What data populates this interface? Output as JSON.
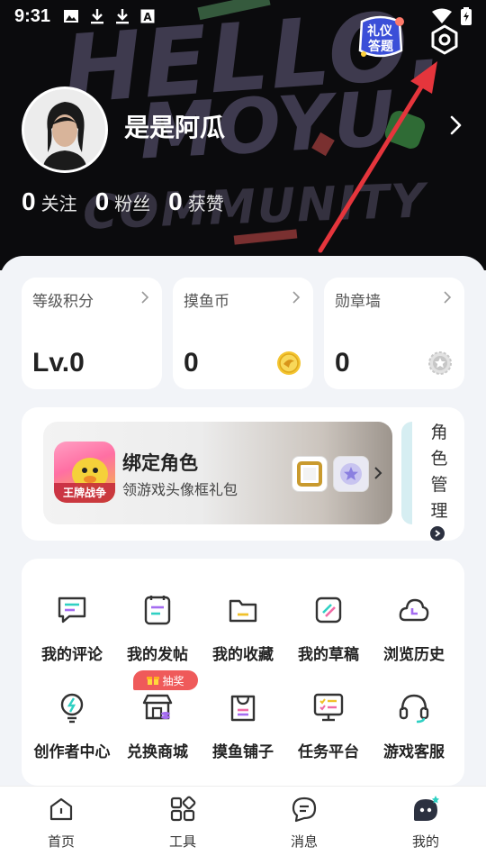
{
  "status_bar": {
    "time": "9:31",
    "icons": [
      "image-icon",
      "download-icon",
      "download-icon",
      "keyboard-a-icon",
      "wifi-icon",
      "battery-charging-icon"
    ]
  },
  "header": {
    "background_text": [
      "HELLO.",
      "MOYU",
      "COMMUNITY"
    ],
    "quiz_badge": [
      "礼仪",
      "答题"
    ],
    "settings_icon": "hexagon-settings-icon"
  },
  "profile": {
    "username": "是是阿瓜",
    "stats": [
      {
        "count": "0",
        "label": "关注"
      },
      {
        "count": "0",
        "label": "粉丝"
      },
      {
        "count": "0",
        "label": "获赞"
      }
    ]
  },
  "summary_cards": [
    {
      "title": "等级积分",
      "value": "Lv.0"
    },
    {
      "title": "摸鱼币",
      "value": "0",
      "icon": "coin-icon"
    },
    {
      "title": "勋章墙",
      "value": "0",
      "icon": "medal-icon"
    }
  ],
  "bind_card": {
    "title": "绑定角色",
    "subtitle": "领游戏头像框礼包",
    "game_icon_text": "王牌战争",
    "side_label": [
      "角",
      "色",
      "管",
      "理"
    ]
  },
  "lottery_badge": "抽奖",
  "grid_items": [
    {
      "label": "我的评论",
      "icon": "comment-icon"
    },
    {
      "label": "我的发帖",
      "icon": "post-icon"
    },
    {
      "label": "我的收藏",
      "icon": "folder-icon"
    },
    {
      "label": "我的草稿",
      "icon": "draft-icon"
    },
    {
      "label": "浏览历史",
      "icon": "history-cloud-icon"
    },
    {
      "label": "创作者中心",
      "icon": "lightbulb-icon"
    },
    {
      "label": "兑换商城",
      "icon": "store-icon"
    },
    {
      "label": "摸鱼铺子",
      "icon": "shopping-bag-icon"
    },
    {
      "label": "任务平台",
      "icon": "task-monitor-icon"
    },
    {
      "label": "游戏客服",
      "icon": "headset-icon"
    }
  ],
  "tabs": [
    {
      "label": "首页",
      "icon": "home-icon"
    },
    {
      "label": "工具",
      "icon": "tools-grid-icon"
    },
    {
      "label": "消息",
      "icon": "message-icon"
    },
    {
      "label": "我的",
      "icon": "profile-bot-icon",
      "active": true
    }
  ],
  "colors": {
    "header_bg": "#0b0b0d",
    "panel_bg": "#f2f4f8",
    "accent_purple": "#a46cf0",
    "accent_teal": "#2fd0c3",
    "accent_pink": "#f06aa5",
    "arrow_red": "#e5353c",
    "lottery_red": "#ef5a5a"
  }
}
